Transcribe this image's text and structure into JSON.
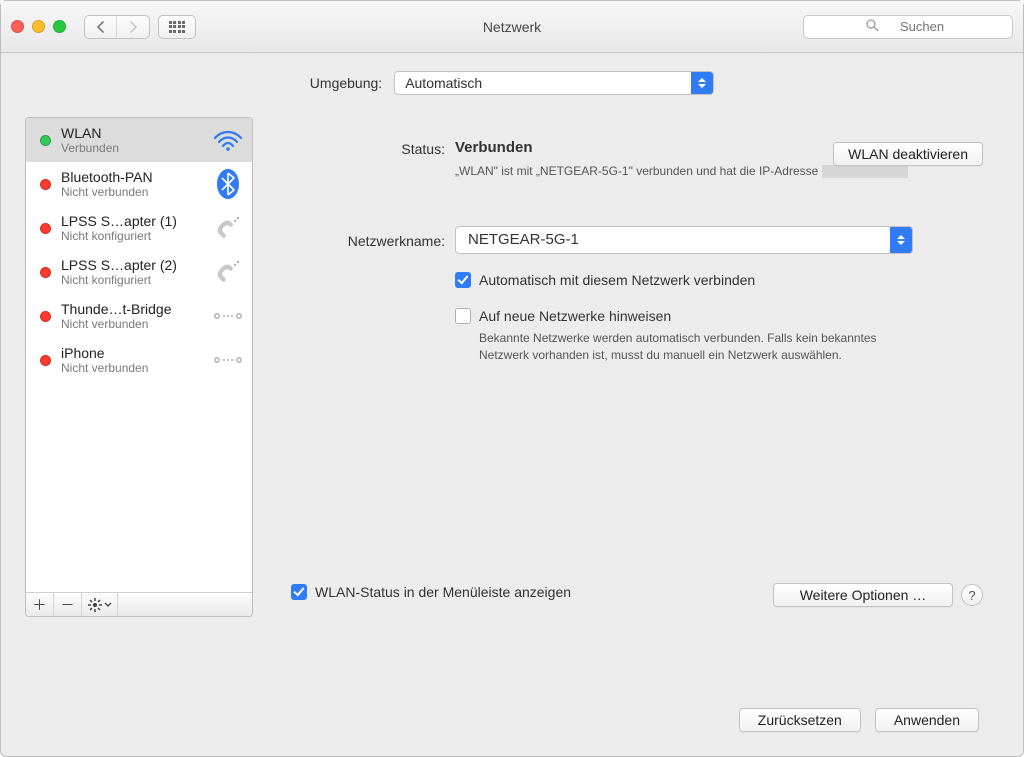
{
  "window": {
    "title": "Netzwerk",
    "search_placeholder": "Suchen"
  },
  "env": {
    "label": "Umgebung:",
    "value": "Automatisch"
  },
  "services": [
    {
      "name": "WLAN",
      "subtitle": "Verbunden",
      "status": "green",
      "icon": "wifi"
    },
    {
      "name": "Bluetooth-PAN",
      "subtitle": "Nicht verbunden",
      "status": "red",
      "icon": "bluetooth"
    },
    {
      "name": "LPSS S…apter (1)",
      "subtitle": "Nicht konfiguriert",
      "status": "red",
      "icon": "phone"
    },
    {
      "name": "LPSS S…apter (2)",
      "subtitle": "Nicht konfiguriert",
      "status": "red",
      "icon": "phone"
    },
    {
      "name": "Thunde…t-Bridge",
      "subtitle": "Nicht verbunden",
      "status": "red",
      "icon": "bridge"
    },
    {
      "name": "iPhone",
      "subtitle": "Nicht verbunden",
      "status": "red",
      "icon": "bridge"
    }
  ],
  "detail": {
    "status_label": "Status:",
    "status_value": "Verbunden",
    "deactivate": "WLAN deaktivieren",
    "help_text_pre": "„WLAN\" ist mit „NETGEAR-5G-1\" verbunden und hat die IP-Adresse ",
    "network_label": "Netzwerkname:",
    "network_value": "NETGEAR-5G-1",
    "auto_join": "Automatisch mit diesem Netzwerk verbinden",
    "notify_new": "Auf neue Netzwerke hinweisen",
    "notify_help": "Bekannte Netzwerke werden automatisch verbunden. Falls kein bekanntes Netzwerk vorhanden ist, musst du manuell ein Netzwerk auswählen.",
    "menubar_status": "WLAN-Status in der Menüleiste anzeigen",
    "more_options": "Weitere Optionen …"
  },
  "footer": {
    "reset": "Zurücksetzen",
    "apply": "Anwenden"
  }
}
